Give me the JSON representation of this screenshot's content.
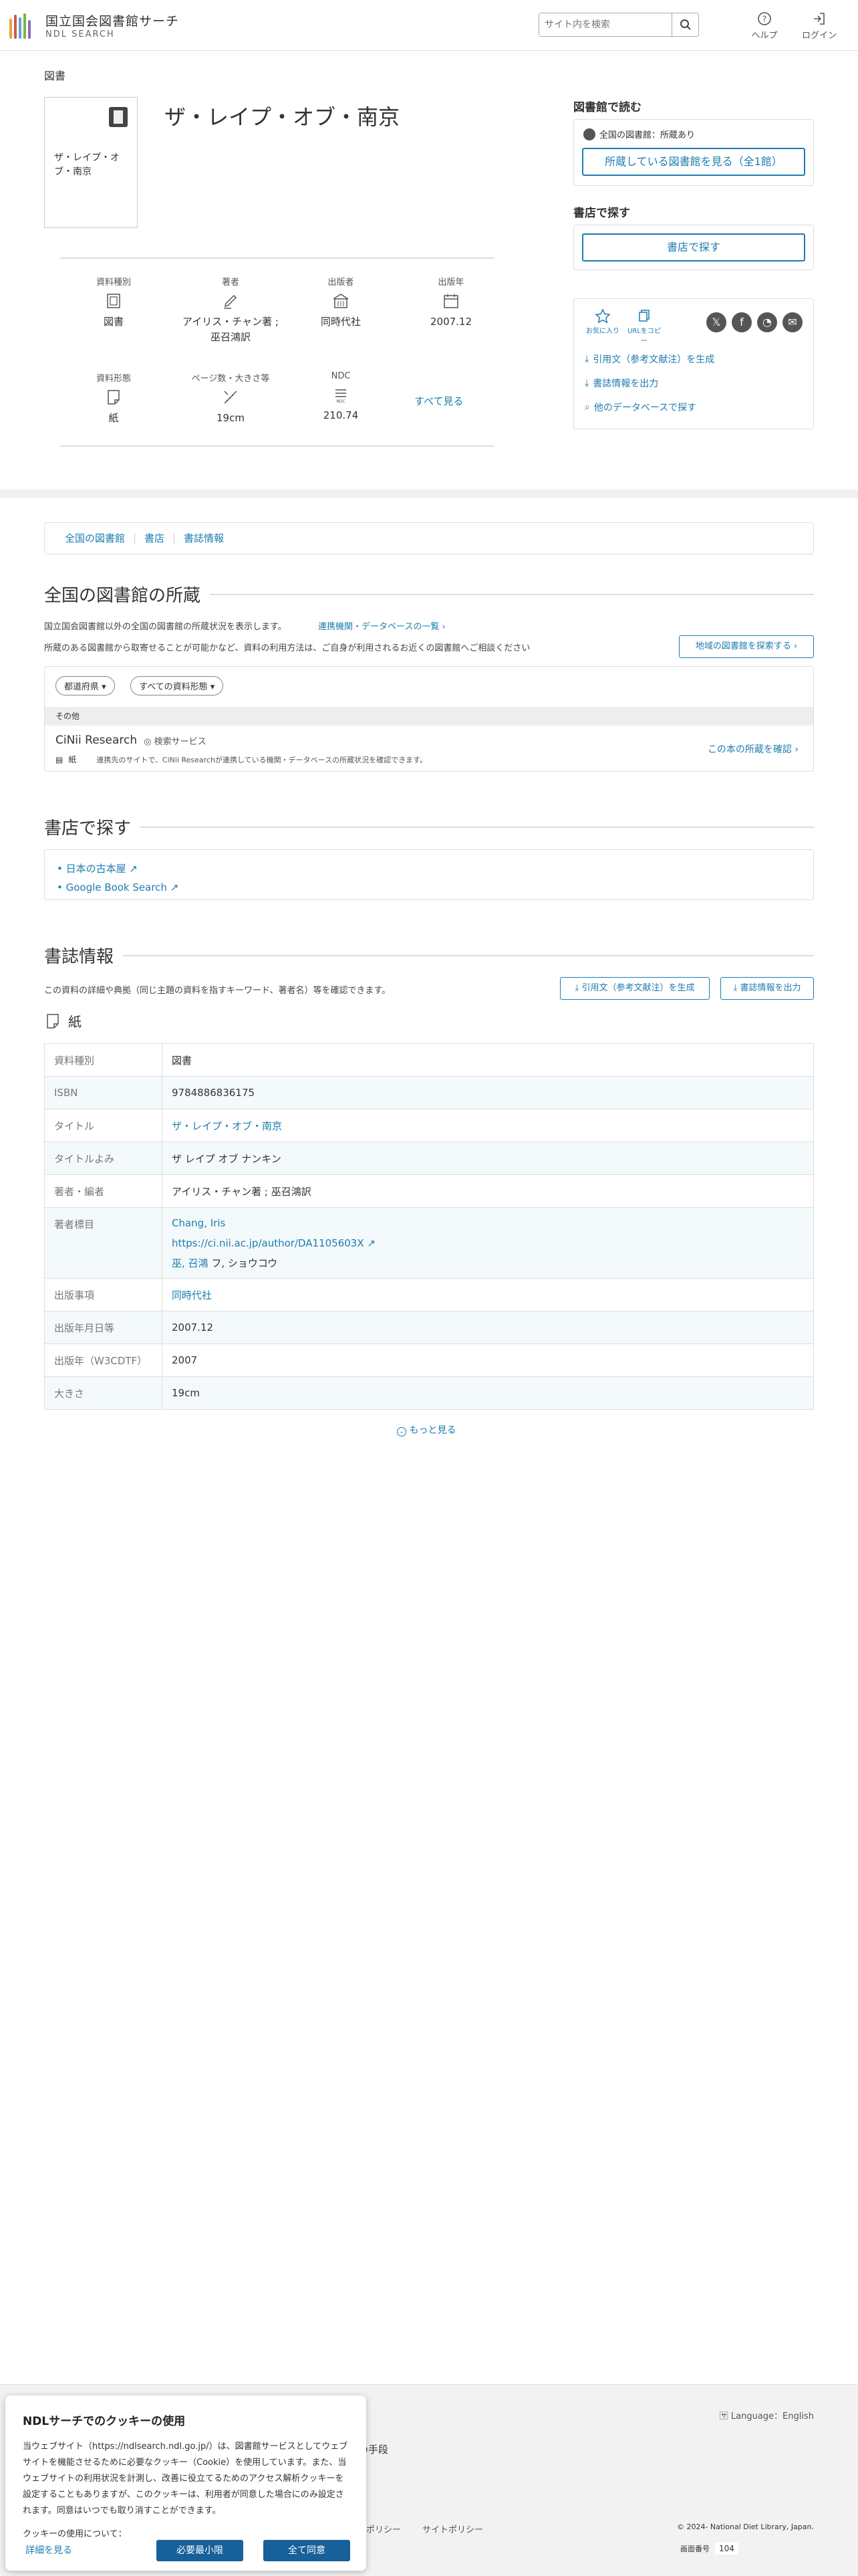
{
  "header": {
    "logo_jp": "国立国会図書館サーチ",
    "logo_en": "NDL SEARCH",
    "search_placeholder": "サイト内を検索",
    "help": "ヘルプ",
    "login": "ログイン"
  },
  "record": {
    "type_label": "図書",
    "cover_title": "ザ・レイプ・オブ・南京",
    "title": "ザ・レイプ・オブ・南京",
    "facts": [
      {
        "label": "資料種別",
        "icon": "book-icon",
        "value": "図書"
      },
      {
        "label": "著者",
        "icon": "pen-icon",
        "value": "アイリス・チャン著 ; 巫召鴻訳"
      },
      {
        "label": "出版者",
        "icon": "building-icon",
        "value": "同時代社"
      },
      {
        "label": "出版年",
        "icon": "calendar-icon",
        "value": "2007.12"
      },
      {
        "label": "資料形態",
        "icon": "paper-icon",
        "value": "紙"
      },
      {
        "label": "ページ数・大きさ等",
        "icon": "ruler-pencil-icon",
        "value": "19cm"
      },
      {
        "label": "NDC",
        "icon": "ndc-icon",
        "value": "210.74"
      }
    ],
    "see_all": "すべて見る"
  },
  "side": {
    "read_heading": "図書館で読む",
    "holding_status": "全国の図書館：所蔵あり",
    "holding_button": "所蔵している図書館を見る（全1館）",
    "store_heading": "書店で探す",
    "store_button": "書店で探す",
    "favorite": "お気に入り",
    "copy_url": "URLをコピー",
    "cite": "引用文（参考文献注）を生成",
    "export": "書誌情報を出力",
    "other_db": "他のデータベースで探す"
  },
  "tabs": [
    "全国の図書館",
    "書店",
    "書誌情報"
  ],
  "libraries": {
    "heading": "全国の図書館の所蔵",
    "note1": "国立国会図書館以外の全国の図書館の所蔵状況を表示します。",
    "link_list": "連携機関・データベースの一覧",
    "note2": "所蔵のある図書館から取寄せることが可能かなど、資料の利用方法は、ご自身が利用されるお近くの図書館へご相談ください",
    "region_button": "地域の図書館を探索する",
    "filter_pref": "都道府県 ▾",
    "filter_type": "すべての資料形態 ▾",
    "group": "その他",
    "service_name": "CiNii Research",
    "service_tag": "検索サービス",
    "service_form": "紙",
    "service_desc": "連携先のサイトで、CiNii Researchが連携している機関・データベースの所蔵状況を確認できます。",
    "confirm_link": "この本の所蔵を確認"
  },
  "stores": {
    "heading": "書店で探す",
    "links": [
      "日本の古本屋",
      "Google Book Search"
    ]
  },
  "bib": {
    "heading": "書誌情報",
    "note": "この資料の詳細や典拠（同じ主題の資料を指すキーワード、著者名）等を確認できます。",
    "cite_button": "引用文（参考文献注）を生成",
    "export_button": "書誌情報を出力",
    "form": "紙",
    "rows": [
      {
        "k": "資料種別",
        "v": "図書"
      },
      {
        "k": "ISBN",
        "v": "9784886836175"
      },
      {
        "k": "タイトル",
        "v": "ザ・レイプ・オブ・南京"
      },
      {
        "k": "タイトルよみ",
        "v": "ザ レイプ オブ ナンキン"
      },
      {
        "k": "著者・編者",
        "v": "アイリス・チャン著 ; 巫召鴻訳"
      },
      {
        "k": "著者標目",
        "v": "Chang, Iris"
      },
      {
        "k": "出版事項",
        "v": "同時代社"
      },
      {
        "k": "出版年月日等",
        "v": "2007.12"
      },
      {
        "k": "出版年（W3CDTF）",
        "v": "2007"
      },
      {
        "k": "大きさ",
        "v": "19cm"
      }
    ],
    "author_url": "https://ci.nii.ac.jp/author/DA1105603X",
    "author_2": "巫, 召鴻",
    "author_2_reading": " フ, ショウコウ",
    "more": "もっと見る"
  },
  "footer": {
    "language": "Language：English",
    "partial_method": "の手段",
    "policy1": "ポリシー",
    "policy2": "サイトポリシー",
    "copyright": "© 2024- National Diet Library, Japan.",
    "screen_no_label": "画面番号",
    "screen_no": "104"
  },
  "cookie": {
    "title": "NDLサーチでのクッキーの使用",
    "body": "当ウェブサイト（https://ndlsearch.ndl.go.jp/）は、図書館サービスとしてウェブサイトを機能させるために必要なクッキー（Cookie）を使用しています。また、当ウェブサイトの利用状況を計測し、改善に役立てるためのアクセス解析クッキーを設定することもありますが、このクッキーは、利用者が同意した場合にのみ設定されます。同意はいつでも取り消すことができます。",
    "about": "クッキーの使用について：",
    "detail": "詳細を見る",
    "minimal": "必要最小限",
    "accept": "全て同意"
  },
  "colors": {
    "accent": "#1d7cb0",
    "navy": "#17609a"
  }
}
